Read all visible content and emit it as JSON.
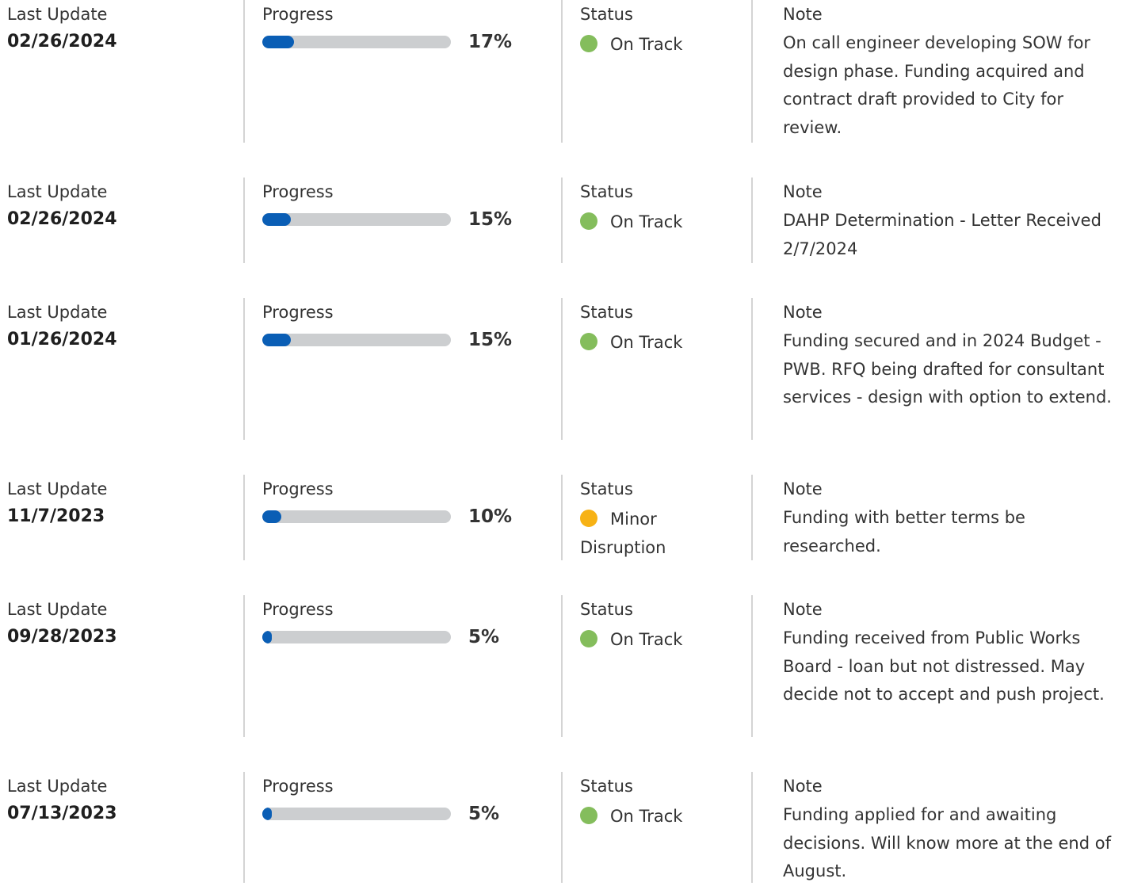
{
  "labels": {
    "last_update": "Last Update",
    "progress": "Progress",
    "status": "Status",
    "note": "Note"
  },
  "colors": {
    "bar_fill": "#0a5eb5",
    "bar_track": "#ccced0",
    "on_track": "#84bd5c",
    "minor_disruption": "#f7b215",
    "divider": "#d4d4d4"
  },
  "updates": [
    {
      "date": "02/26/2024",
      "progress": 17,
      "progress_label": "17%",
      "status": "On Track",
      "status_color": "#84bd5c",
      "note": "On call engineer developing SOW for design phase. Funding acquired and contract draft provided to City for review."
    },
    {
      "date": "02/26/2024",
      "progress": 15,
      "progress_label": "15%",
      "status": "On Track",
      "status_color": "#84bd5c",
      "note": "DAHP Determination - Letter Received 2/7/2024"
    },
    {
      "date": "01/26/2024",
      "progress": 15,
      "progress_label": "15%",
      "status": "On Track",
      "status_color": "#84bd5c",
      "note": "Funding secured and in 2024 Budget - PWB. RFQ being drafted for consultant services - design with option to extend."
    },
    {
      "date": "11/7/2023",
      "progress": 10,
      "progress_label": "10%",
      "status": "Minor Disruption",
      "status_color": "#f7b215",
      "note": "Funding with better terms be researched."
    },
    {
      "date": "09/28/2023",
      "progress": 5,
      "progress_label": "5%",
      "status": "On Track",
      "status_color": "#84bd5c",
      "note": "Funding received from Public Works Board - loan but not distressed. May decide not to accept and push project."
    },
    {
      "date": "07/13/2023",
      "progress": 5,
      "progress_label": "5%",
      "status": "On Track",
      "status_color": "#84bd5c",
      "note": "Funding applied for and awaiting decisions. Will know more at the end of August."
    }
  ]
}
